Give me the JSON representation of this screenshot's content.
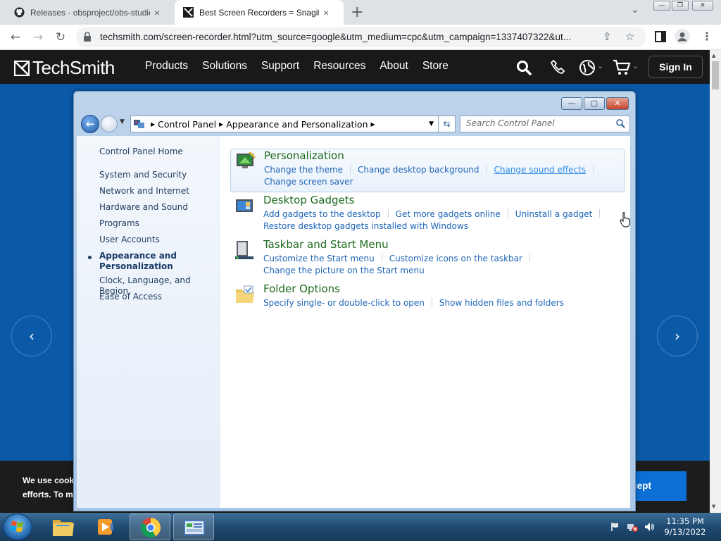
{
  "browser": {
    "tabs": [
      {
        "title": "Releases · obsproject/obs-studio",
        "close": "×"
      },
      {
        "title": "Best Screen Recorders = Snagit",
        "close": "×"
      }
    ],
    "new_tab": "+",
    "tab_dropdown": "⌄",
    "url": "techsmith.com/screen-recorder.html?utm_source=google&utm_medium=cpc&utm_campaign=1337407322&ut...",
    "back": "←",
    "forward": "→",
    "reload": "↻"
  },
  "site": {
    "logo_text": "TechSmith",
    "nav": [
      "Products",
      "Solutions",
      "Support",
      "Resources",
      "About",
      "Store"
    ],
    "sign_in": "Sign In",
    "carousel_prev": "‹",
    "carousel_next": "›",
    "cookie": {
      "line1": "We use cook",
      "line2": "efforts. To m",
      "accept": "Accept"
    }
  },
  "control_panel": {
    "breadcrumb": [
      "Control Panel",
      "Appearance and Personalization"
    ],
    "search_placeholder": "Search Control Panel",
    "left_nav": [
      {
        "label": "Control Panel Home"
      },
      {
        "label": "System and Security"
      },
      {
        "label": "Network and Internet"
      },
      {
        "label": "Hardware and Sound"
      },
      {
        "label": "Programs"
      },
      {
        "label": "User Accounts"
      },
      {
        "label": "Appearance and Personalization",
        "line1": "Appearance and",
        "line2": "Personalization",
        "active": true
      },
      {
        "label": "Clock, Language, and Region"
      },
      {
        "label": "Ease of Access"
      }
    ],
    "categories": [
      {
        "title": "Personalization",
        "links": [
          "Change the theme",
          "Change desktop background",
          "Change sound effects",
          "Change screen saver"
        ]
      },
      {
        "title": "Desktop Gadgets",
        "links": [
          "Add gadgets to the desktop",
          "Get more gadgets online",
          "Uninstall a gadget",
          "Restore desktop gadgets installed with Windows"
        ]
      },
      {
        "title": "Taskbar and Start Menu",
        "links": [
          "Customize the Start menu",
          "Customize icons on the taskbar",
          "Change the picture on the Start menu"
        ]
      },
      {
        "title": "Folder Options",
        "links": [
          "Specify single- or double-click to open",
          "Show hidden files and folders"
        ]
      }
    ]
  },
  "taskbar": {
    "time": "11:35 PM",
    "date": "9/13/2022"
  },
  "colors": {
    "site_header": "#191919",
    "hero_blue": "#0b5aa8",
    "link_blue": "#1e65b7",
    "category_green": "#1c6a1c"
  }
}
